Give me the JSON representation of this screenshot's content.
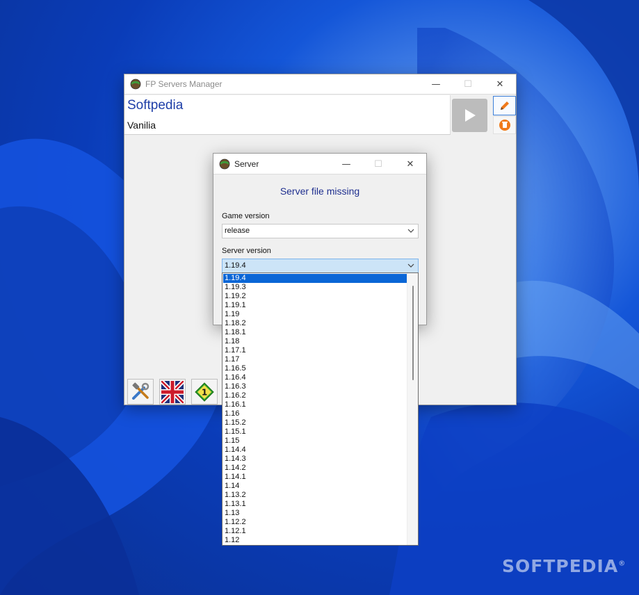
{
  "main_window": {
    "title": "FP Servers Manager",
    "server_name": "Softpedia",
    "server_type": "Vanilia",
    "controls": {
      "minimize": "—",
      "maximize": "☐",
      "close": "✕"
    }
  },
  "toolbar": {
    "icons": [
      "tools-icon",
      "uk-flag-icon",
      "update-badge-icon"
    ],
    "badge_number": "1"
  },
  "dialog": {
    "title": "Server",
    "heading": "Server file missing",
    "game_version_label": "Game version",
    "game_version_value": "release",
    "server_version_label": "Server version",
    "server_version_value": "1.19.4",
    "controls": {
      "minimize": "—",
      "maximize": "☐",
      "close": "✕"
    }
  },
  "server_version_options": [
    "1.19.4",
    "1.19.3",
    "1.19.2",
    "1.19.1",
    "1.19",
    "1.18.2",
    "1.18.1",
    "1.18",
    "1.17.1",
    "1.17",
    "1.16.5",
    "1.16.4",
    "1.16.3",
    "1.16.2",
    "1.16.1",
    "1.16",
    "1.15.2",
    "1.15.1",
    "1.15",
    "1.14.4",
    "1.14.3",
    "1.14.2",
    "1.14.1",
    "1.14",
    "1.13.2",
    "1.13.1",
    "1.13",
    "1.12.2",
    "1.12.1",
    "1.12"
  ],
  "selected_option_index": 0,
  "watermark": "SOFTPEDIA",
  "watermark_mark": "®",
  "colors": {
    "accent_blue": "#1f3fa8",
    "selection_blue": "#0a66d6",
    "play_button_gray": "#bcbcbc",
    "icon_orange": "#f07a1a"
  }
}
